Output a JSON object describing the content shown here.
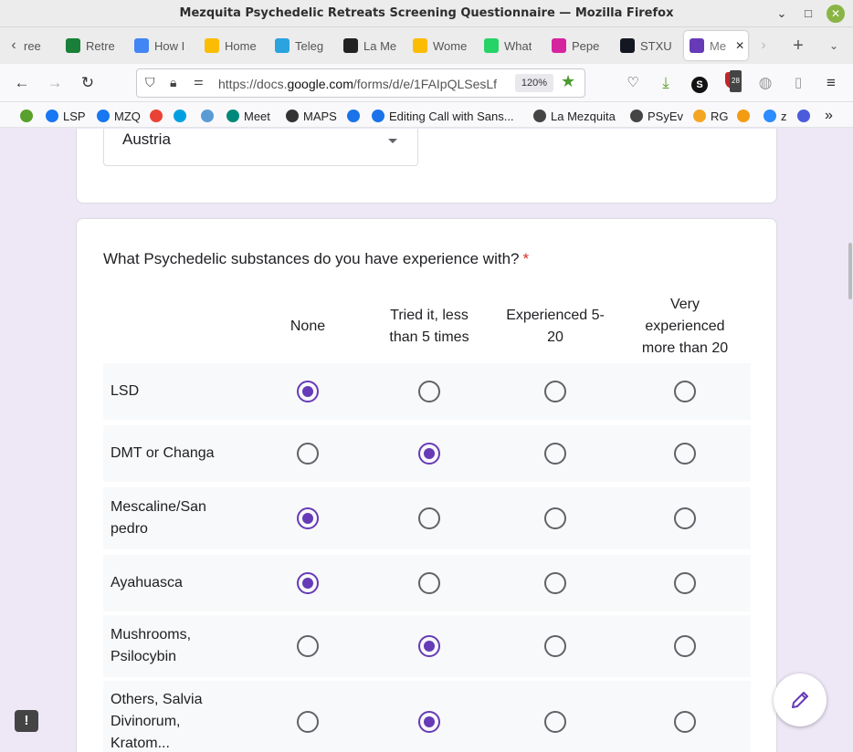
{
  "window": {
    "title": "Mezquita Psychedelic Retreats Screening Questionnaire — Mozilla Firefox",
    "minimize": "⌄",
    "maximize": "□",
    "close": "✕"
  },
  "tabs": [
    {
      "label": "ree",
      "icon": "tab-icon",
      "color": "#ffffff"
    },
    {
      "label": "Retre",
      "icon": "google-sheets-icon",
      "color": "#188038"
    },
    {
      "label": "How I",
      "icon": "google-docs-icon",
      "color": "#4285f4"
    },
    {
      "label": "Home",
      "icon": "google-drive-icon",
      "color": "#fbbc04"
    },
    {
      "label": "Teleg",
      "icon": "telegram-icon",
      "color": "#2aa3df"
    },
    {
      "label": "La Me",
      "icon": "book-icon",
      "color": "#222222"
    },
    {
      "label": "Wome",
      "icon": "google-drive-icon",
      "color": "#fbbc04"
    },
    {
      "label": "What",
      "icon": "whatsapp-icon",
      "color": "#25d366"
    },
    {
      "label": "Pepe",
      "icon": "instagram-icon",
      "color": "#d6249f"
    },
    {
      "label": "STXU",
      "icon": "tradingview-icon",
      "color": "#131722"
    },
    {
      "label": "Me",
      "icon": "google-forms-icon",
      "color": "#673ab7",
      "active": true
    }
  ],
  "nav": {
    "url_prefix": "https://docs.",
    "url_domain": "google.com",
    "url_rest": "/forms/d/e/1FAIpQLSesLf",
    "zoom": "120%",
    "extension_badge": "28"
  },
  "bookmarks": [
    {
      "label": "",
      "icon": "green-circle-icon",
      "color": "#5aa02c"
    },
    {
      "label": "LSP",
      "icon": "facebook-icon",
      "color": "#1877f2"
    },
    {
      "label": "MZQ",
      "icon": "facebook-icon",
      "color": "#1877f2"
    },
    {
      "label": "",
      "icon": "gmail-icon",
      "color": "#ea4335"
    },
    {
      "label": "",
      "icon": "caixa-icon",
      "color": "#00a0e0"
    },
    {
      "label": "",
      "icon": "bank-icon",
      "color": "#5b9bd5"
    },
    {
      "label": "Meet",
      "icon": "google-meet-icon",
      "color": "#00897b"
    },
    {
      "label": "MAPS",
      "icon": "g-icon",
      "color": "#333333"
    },
    {
      "label": "",
      "icon": "blue-ring-icon",
      "color": "#1a73e8"
    },
    {
      "label": "Editing Call with Sans...",
      "icon": "blue-ring-icon",
      "color": "#1a73e8"
    },
    {
      "label": "La Mezquita",
      "icon": "folder-icon",
      "color": "#444444"
    },
    {
      "label": "PSyEv",
      "icon": "folder-icon",
      "color": "#444444"
    },
    {
      "label": "RG",
      "icon": "rg-icon",
      "color": "#f4a623"
    },
    {
      "label": "",
      "icon": "grid-icon",
      "color": "#f39c12"
    },
    {
      "label": "z",
      "icon": "zm-icon",
      "color": "#2d8cff"
    },
    {
      "label": "",
      "icon": "m-icon",
      "color": "#4b5bdc"
    }
  ],
  "form": {
    "country_value": "Austria",
    "question": "What Psychedelic substances do you have experience with?",
    "required_mark": "*",
    "columns": [
      "None",
      "Tried it, less than 5 times",
      "Experienced 5-20",
      "Very experienced more than 20"
    ],
    "rows": [
      {
        "label": "LSD",
        "selected": 0
      },
      {
        "label": "DMT or Changa",
        "selected": 1
      },
      {
        "label": "Mescaline/San pedro",
        "selected": 0
      },
      {
        "label": "Ayahuasca",
        "selected": 0
      },
      {
        "label": "Mushrooms, Psilocybin",
        "selected": 1
      },
      {
        "label": "Others, Salvia Divinorum, Kratom...",
        "selected": 1
      }
    ],
    "accent_color": "#673ab7"
  },
  "report_label": "!"
}
